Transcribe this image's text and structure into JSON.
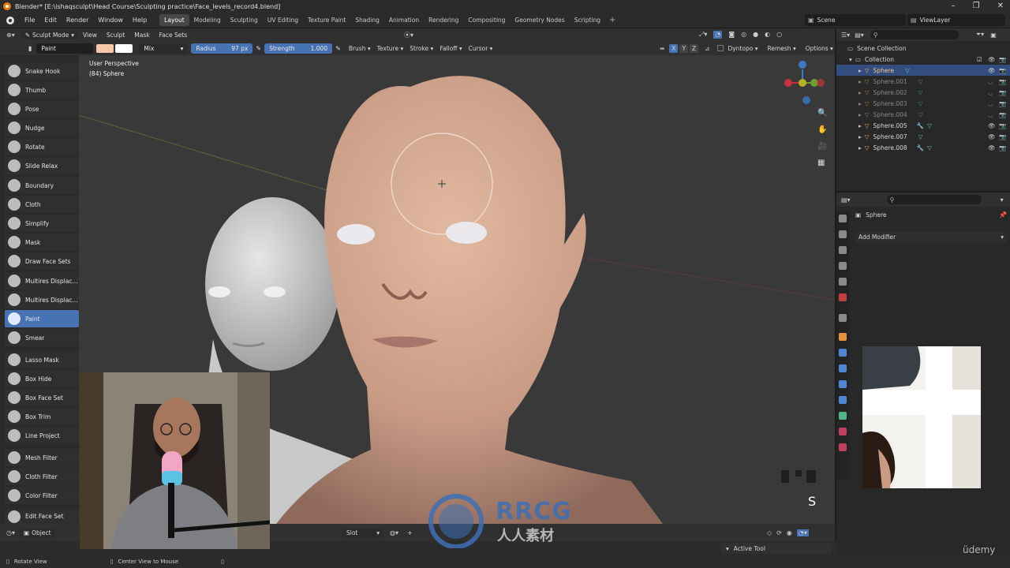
{
  "window": {
    "title": "Blender* [E:\\ishaqsculpt\\Head Course\\Sculpting practice\\Face_levels_record4.blend]",
    "controls": [
      "–",
      "❐",
      "✕"
    ]
  },
  "menu": {
    "items": [
      "File",
      "Edit",
      "Render",
      "Window",
      "Help"
    ],
    "workspaces": [
      "Layout",
      "Modeling",
      "Sculpting",
      "UV Editing",
      "Texture Paint",
      "Shading",
      "Animation",
      "Rendering",
      "Compositing",
      "Geometry Nodes",
      "Scripting"
    ],
    "active_workspace": "Layout",
    "scene": "Scene",
    "view_layer": "ViewLayer"
  },
  "header": {
    "mode": "Sculpt Mode",
    "menus": [
      "View",
      "Sculpt",
      "Mask",
      "Face Sets"
    ]
  },
  "tool_settings": {
    "brush_name": "Paint",
    "blend_mode": "Mix",
    "radius_label": "Radius",
    "radius_value": "97 px",
    "strength_label": "Strength",
    "strength_value": "1.000",
    "menus": [
      "Brush",
      "Texture",
      "Stroke",
      "Falloff",
      "Cursor"
    ],
    "axes": [
      "X",
      "Y",
      "Z"
    ],
    "dyntopo": "Dyntopo",
    "remesh": "Remesh",
    "options": "Options",
    "colors": {
      "primary": "#f7c9a8",
      "secondary": "#ffffff",
      "active": "#4772b3"
    }
  },
  "viewport": {
    "view_label": "User Perspective",
    "object_label": "(84) Sphere",
    "key_indicator": "S"
  },
  "toolbar": {
    "tools": [
      {
        "label": "Snake Hook",
        "icon": "snake-hook-icon"
      },
      {
        "label": "Thumb",
        "icon": "thumb-icon"
      },
      {
        "label": "Pose",
        "icon": "pose-icon"
      },
      {
        "label": "Nudge",
        "icon": "nudge-icon"
      },
      {
        "label": "Rotate",
        "icon": "rotate-icon"
      },
      {
        "label": "Slide Relax",
        "icon": "slide-relax-icon"
      },
      {
        "label": "Boundary",
        "icon": "boundary-icon"
      },
      {
        "label": "Cloth",
        "icon": "cloth-icon"
      },
      {
        "label": "Simplify",
        "icon": "simplify-icon"
      },
      {
        "label": "Mask",
        "icon": "mask-icon"
      },
      {
        "label": "Draw Face Sets",
        "icon": "draw-face-sets-icon"
      },
      {
        "label": "Multires Displac...",
        "icon": "multires-icon"
      },
      {
        "label": "Multires Displac...",
        "icon": "multires-icon"
      },
      {
        "label": "Paint",
        "icon": "paint-icon",
        "active": true
      },
      {
        "label": "Smear",
        "icon": "smear-icon"
      },
      {
        "label": "Lasso Mask",
        "icon": "lasso-mask-icon"
      },
      {
        "label": "Box Hide",
        "icon": "box-hide-icon"
      },
      {
        "label": "Box Face Set",
        "icon": "box-face-set-icon"
      },
      {
        "label": "Box Trim",
        "icon": "box-trim-icon"
      },
      {
        "label": "Line Project",
        "icon": "line-project-icon"
      },
      {
        "label": "Mesh Filter",
        "icon": "mesh-filter-icon"
      },
      {
        "label": "Cloth Filter",
        "icon": "cloth-filter-icon"
      },
      {
        "label": "Color Filter",
        "icon": "color-filter-icon"
      },
      {
        "label": "Edit Face Set",
        "icon": "edit-face-set-icon"
      }
    ]
  },
  "bottom": {
    "object_mode": "Object",
    "slot": "Slot",
    "active_tool": "Active Tool"
  },
  "outliner": {
    "scene_collection": "Scene Collection",
    "collection": "Collection",
    "objects": [
      {
        "name": "Sphere",
        "selected": true
      },
      {
        "name": "Sphere.001"
      },
      {
        "name": "Sphere.002"
      },
      {
        "name": "Sphere.003"
      },
      {
        "name": "Sphere.004"
      },
      {
        "name": "Sphere.005"
      },
      {
        "name": "Sphere.007"
      },
      {
        "name": "Sphere.008"
      }
    ]
  },
  "properties": {
    "object_name": "Sphere",
    "add_modifier": "Add Modifier"
  },
  "status": {
    "left": "Rotate View",
    "middle": "Center View to Mouse"
  },
  "overlay": {
    "watermark_title": "RRCG",
    "watermark_sub": "人人素材",
    "udemy": "üdemy"
  }
}
